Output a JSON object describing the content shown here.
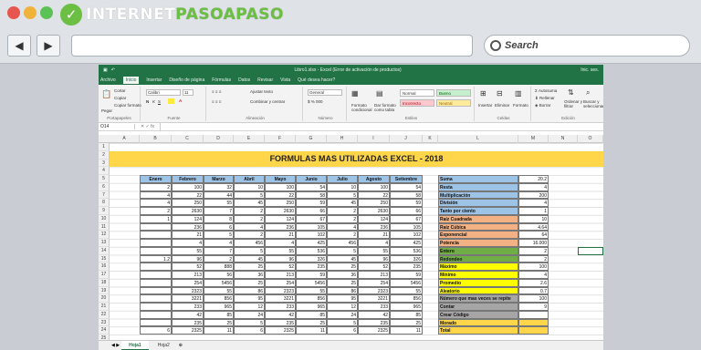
{
  "browser": {
    "logo_prefix": "INTERNET",
    "logo_suffix": "PASOAPASO",
    "search_label": "Search",
    "back_icon": "◀",
    "forward_icon": "▶"
  },
  "excel": {
    "title": "Libro1.xlsx - Excel (Error de activación de productos)",
    "user": "Inic. ses.",
    "tabs": [
      "Archivo",
      "Inicio",
      "Insertar",
      "Diseño de página",
      "Fórmulas",
      "Datos",
      "Revisar",
      "Vista",
      "Qué desea hacer?"
    ],
    "active_tab": "Inicio",
    "ribbon": {
      "clipboard": {
        "cut": "Cortar",
        "copy": "Copiar",
        "format": "Copiar formato",
        "paste": "Pegar",
        "label": "Portapapeles"
      },
      "font": {
        "name": "Calibri",
        "size": "11",
        "label": "Fuente"
      },
      "align": {
        "wrap": "Ajustar texto",
        "merge": "Combinar y centrar",
        "label": "Alineación"
      },
      "number": {
        "format": "General",
        "label": "Número"
      },
      "styles": {
        "cond": "Formato condicional",
        "table": "Dar formato como tabla",
        "normal": "Normal",
        "bueno": "Bueno",
        "incorrecto": "Incorrecto",
        "neutral": "Neutral",
        "label": "Estilos"
      },
      "cells": {
        "insert": "Insertar",
        "delete": "Eliminar",
        "format": "Formato",
        "label": "Celdas"
      },
      "edit": {
        "autosum": "Autosuma",
        "fill": "Rellenar",
        "clear": "Borrar",
        "sort": "Ordenar y filtrar",
        "find": "Buscar y seleccionar",
        "label": "Edición"
      }
    },
    "name_box": "O14",
    "columns": [
      "A",
      "B",
      "C",
      "D",
      "E",
      "F",
      "G",
      "H",
      "I",
      "J",
      "K",
      "L",
      "M",
      "N",
      "O"
    ],
    "sheet_title": "FORMULAS MAS UTILIZADAS EXCEL - 2018",
    "month_headers": [
      "Enero",
      "Febrero",
      "Marzo",
      "Abril",
      "Mayo",
      "Junio",
      "Julio",
      "Agosto",
      "Setiembre"
    ],
    "table_rows": [
      [
        "2",
        "100",
        "32",
        "10",
        "100",
        "54",
        "10",
        "100",
        "54"
      ],
      [
        "4",
        "22",
        "44",
        "5",
        "22",
        "58",
        "5",
        "22",
        "58"
      ],
      [
        "4",
        "250",
        "55",
        "45",
        "250",
        "59",
        "45",
        "250",
        "59"
      ],
      [
        "2",
        "2630",
        "7",
        "2",
        "2630",
        "66",
        "2",
        "2630",
        "66"
      ],
      [
        "1",
        "124",
        "8",
        "2",
        "124",
        "67",
        "2",
        "124",
        "67"
      ],
      [
        "",
        "236",
        "6",
        "4",
        "236",
        "105",
        "4",
        "236",
        "105"
      ],
      [
        "",
        "21",
        "5",
        "2",
        "21",
        "102",
        "2",
        "21",
        "102"
      ],
      [
        "",
        "4",
        "4",
        "456",
        "4",
        "425",
        "456",
        "4",
        "425"
      ],
      [
        "",
        "55",
        "7",
        "5",
        "55",
        "536",
        "5",
        "55",
        "536"
      ],
      [
        "1.2",
        "96",
        "2",
        "45",
        "96",
        "326",
        "45",
        "96",
        "326"
      ],
      [
        "",
        "52",
        "888",
        "25",
        "52",
        "235",
        "25",
        "52",
        "235"
      ],
      [
        "",
        "213",
        "56",
        "36",
        "213",
        "59",
        "36",
        "213",
        "59"
      ],
      [
        "",
        "254",
        "5456",
        "25",
        "254",
        "5456",
        "25",
        "254",
        "5456"
      ],
      [
        "",
        "2323",
        "55",
        "86",
        "2323",
        "55",
        "86",
        "2323",
        "55"
      ],
      [
        "",
        "3221",
        "856",
        "95",
        "3221",
        "856",
        "95",
        "3221",
        "856"
      ],
      [
        "",
        "233",
        "965",
        "12",
        "233",
        "965",
        "12",
        "233",
        "965"
      ],
      [
        "",
        "42",
        "85",
        "24",
        "42",
        "85",
        "24",
        "42",
        "85"
      ],
      [
        "",
        "235",
        "25",
        "5",
        "235",
        "25",
        "5",
        "235",
        "25"
      ],
      [
        "6",
        "2325",
        "11",
        "6",
        "2325",
        "11",
        "6",
        "2325",
        "11"
      ]
    ],
    "formulas": [
      {
        "label": "Suma",
        "value": "20.2",
        "color": "#9dc3e6"
      },
      {
        "label": "Resta",
        "value": "4",
        "color": "#9dc3e6"
      },
      {
        "label": "Multiplicación",
        "value": "200",
        "color": "#9dc3e6"
      },
      {
        "label": "División",
        "value": "4",
        "color": "#9dc3e6"
      },
      {
        "label": "Tanto por ciento",
        "value": "1",
        "color": "#9dc3e6"
      },
      {
        "label": "Raíz Cuadrada",
        "value": "10",
        "color": "#f4b183"
      },
      {
        "label": "Raíz Cúbica",
        "value": "4.64",
        "color": "#f4b183"
      },
      {
        "label": "Exponencial",
        "value": "64",
        "color": "#f4b183"
      },
      {
        "label": "Potencia",
        "value": "16.000",
        "color": "#f4b183"
      },
      {
        "label": "Entero",
        "value": "2",
        "color": "#70ad47"
      },
      {
        "label": "Redondeo",
        "value": "2",
        "color": "#70ad47"
      },
      {
        "label": "Máximo",
        "value": "100",
        "color": "#ffff00"
      },
      {
        "label": "Mínimo",
        "value": "4",
        "color": "#ffff00"
      },
      {
        "label": "Promedio",
        "value": "2.6",
        "color": "#ffff00"
      },
      {
        "label": "Aleatorio",
        "value": "0.7",
        "color": "#ffff00"
      },
      {
        "label": "Número que mas veces se repite",
        "value": "100",
        "color": "#a6a6a6"
      },
      {
        "label": "Contar",
        "value": "9",
        "color": "#a6a6a6"
      },
      {
        "label": "Crear Código",
        "value": "",
        "color": "#a6a6a6"
      },
      {
        "label": "Morado",
        "value": "",
        "color": "#ffd54a"
      },
      {
        "label": "Total",
        "value": "",
        "color": "#ffd54a"
      }
    ],
    "sheets": [
      "Hoja1",
      "Hoja2"
    ],
    "active_sheet": "Hoja1"
  }
}
